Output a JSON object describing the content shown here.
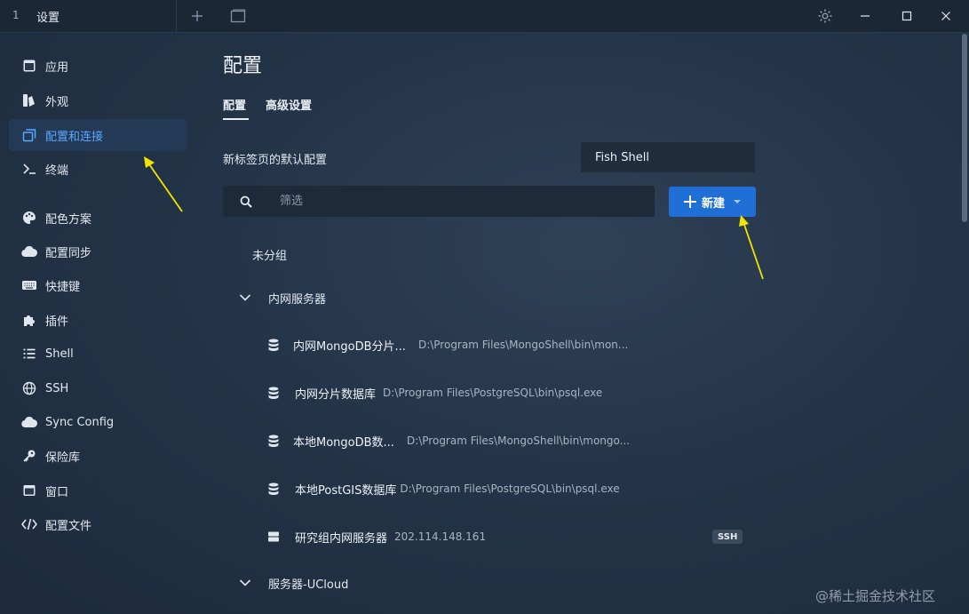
{
  "window": {
    "tab_number": "1",
    "tab_title": "设置",
    "new_tab_icon": "plus-icon",
    "split_icon": "window-split-icon",
    "settings_icon": "gear-icon"
  },
  "sidebar": {
    "items": [
      {
        "label": "应用",
        "icon": "app-icon"
      },
      {
        "label": "外观",
        "icon": "appearance-icon"
      },
      {
        "label": "配置和连接",
        "icon": "profiles-icon",
        "active": true
      },
      {
        "label": "终端",
        "icon": "terminal-icon"
      },
      {
        "label": "配色方案",
        "icon": "palette-icon"
      },
      {
        "label": "配置同步",
        "icon": "cloud-icon"
      },
      {
        "label": "快捷键",
        "icon": "keyboard-icon"
      },
      {
        "label": "插件",
        "icon": "puzzle-icon"
      },
      {
        "label": "Shell",
        "icon": "list-icon"
      },
      {
        "label": "SSH",
        "icon": "globe-icon"
      },
      {
        "label": "Sync Config",
        "icon": "cloud-icon"
      },
      {
        "label": "保险库",
        "icon": "key-icon"
      },
      {
        "label": "窗口",
        "icon": "window-icon"
      },
      {
        "label": "配置文件",
        "icon": "code-icon"
      }
    ]
  },
  "main": {
    "title": "配置",
    "tabs": [
      {
        "label": "配置",
        "active": true
      },
      {
        "label": "高级设置"
      }
    ],
    "default_profile_label": "新标签页的默认配置",
    "default_profile_value": "Fish Shell",
    "filter_placeholder": "筛选",
    "new_button_label": "新建",
    "ungrouped_label": "未分组",
    "groups": [
      {
        "name": "内网服务器",
        "expanded": true,
        "profiles": [
          {
            "name": "内网MongoDB分片...",
            "command": "D:\\Program Files\\MongoShell\\bin\\mon...",
            "icon": "database-icon"
          },
          {
            "name": "内网分片数据库",
            "command": "D:\\Program Files\\PostgreSQL\\bin\\psql.exe",
            "icon": "database-icon"
          },
          {
            "name": "本地MongoDB数...",
            "command": "D:\\Program Files\\MongoShell\\bin\\mongo...",
            "icon": "database-icon"
          },
          {
            "name": "本地PostGIS数据库",
            "command": "D:\\Program Files\\PostgreSQL\\bin\\psql.exe",
            "icon": "database-icon"
          },
          {
            "name": "研究组内网服务器",
            "command": "202.114.148.161",
            "icon": "server-icon",
            "badge": "SSH"
          }
        ]
      },
      {
        "name": "服务器-UCloud",
        "expanded": false
      }
    ]
  },
  "watermark": "@稀土掘金技术社区",
  "colors": {
    "accent": "#1f6fd6",
    "active_text": "#5aa7ff",
    "annotation_arrow": "#f2e600"
  }
}
